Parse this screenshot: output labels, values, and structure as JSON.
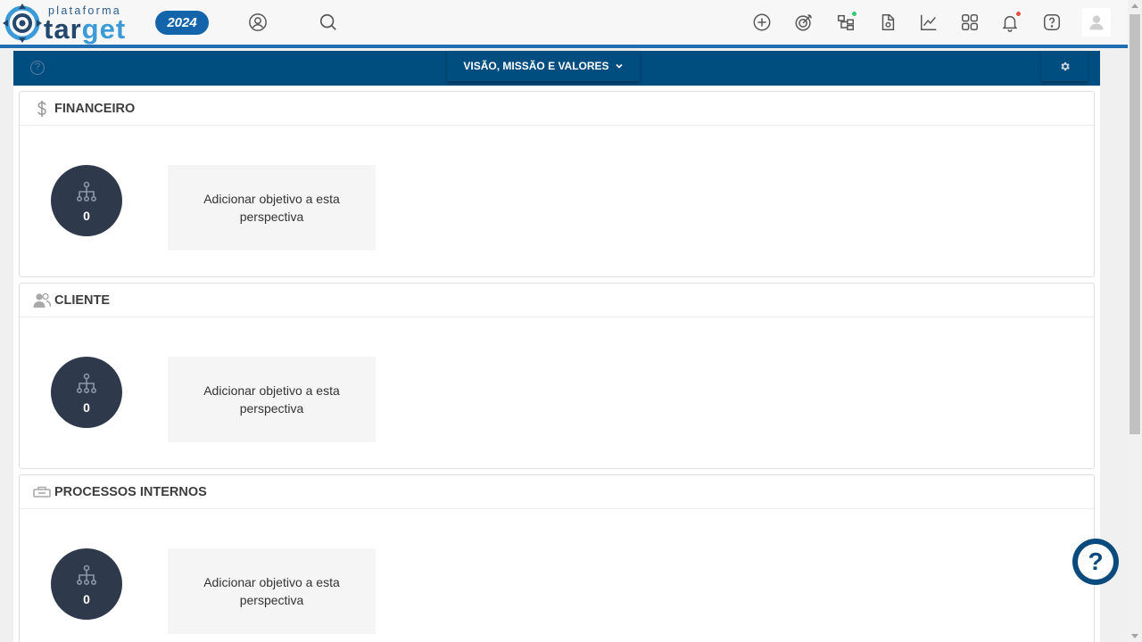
{
  "logo": {
    "small_text": "plataforma",
    "big_text_a": "tar",
    "big_text_b": "get"
  },
  "year_badge": "2024",
  "map_bar": {
    "help_glyph": "?",
    "selector_label": "VISÃO, MISSÃO E VALORES"
  },
  "perspectives": [
    {
      "title": "FINANCEIRO",
      "icon": "dollar-icon",
      "count": "0",
      "add_label": "Adicionar objetivo a esta perspectiva"
    },
    {
      "title": "CLIENTE",
      "icon": "users-icon",
      "count": "0",
      "add_label": "Adicionar objetivo a esta perspectiva"
    },
    {
      "title": "PROCESSOS INTERNOS",
      "icon": "process-icon",
      "count": "0",
      "add_label": "Adicionar objetivo a esta perspectiva"
    }
  ],
  "nav_icons": [
    "profile-icon",
    "search-icon",
    "add-icon",
    "goal-icon",
    "structure-icon",
    "document-icon",
    "chart-icon",
    "apps-icon",
    "bell-icon",
    "help-icon"
  ],
  "help_fab": "?",
  "colors": {
    "brand_blue": "#004d80",
    "circle_bg": "#2e3a4b",
    "notify_green": "#2ecc71",
    "notify_red": "#e74c3c"
  }
}
